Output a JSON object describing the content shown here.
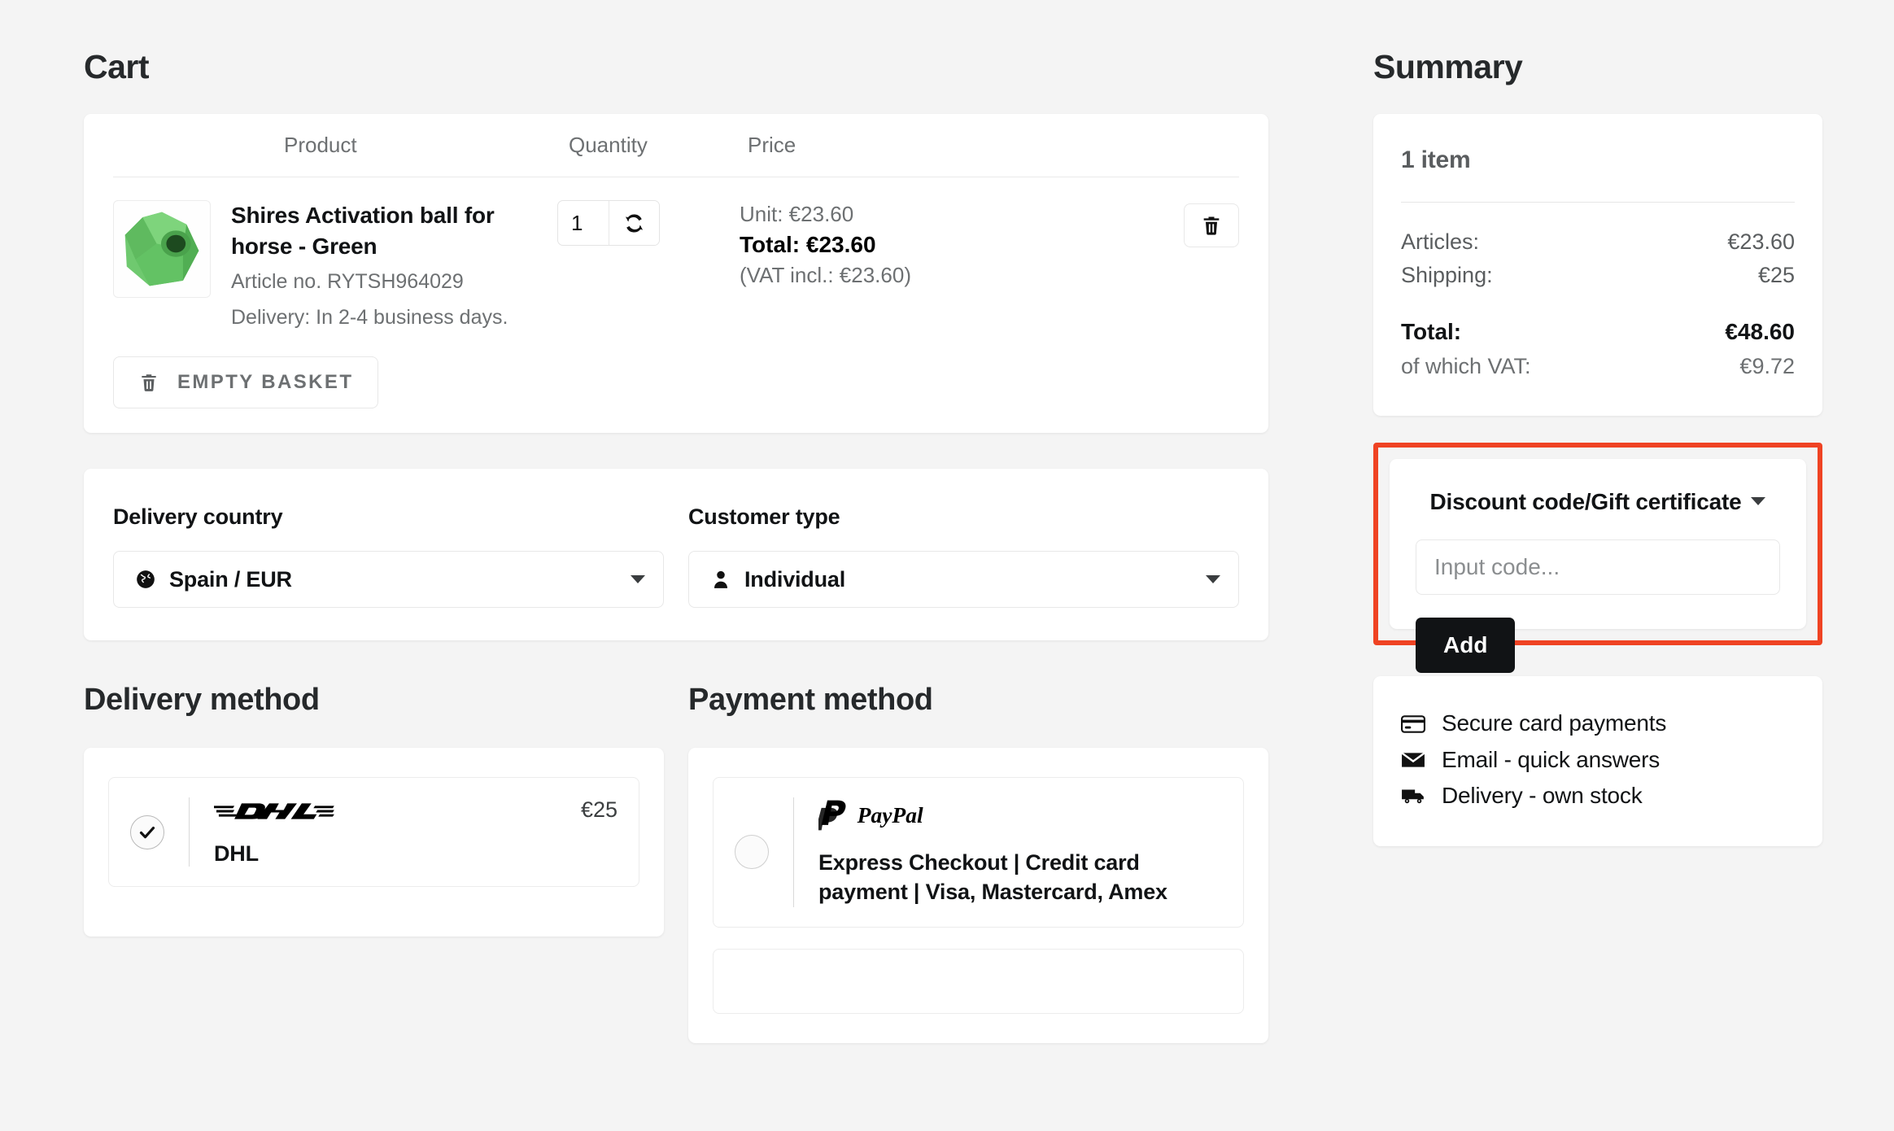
{
  "cart": {
    "title": "Cart",
    "columns": {
      "product": "Product",
      "quantity": "Quantity",
      "price": "Price"
    },
    "items": [
      {
        "name": "Shires Activation ball for horse - Green",
        "article_no": "Article no. RYTSH964029",
        "delivery": "Delivery: In 2-4 business days.",
        "quantity": "1",
        "unit_price": "Unit: €23.60",
        "total_price": "Total: €23.60",
        "vat_note": "(VAT incl.: €23.60)",
        "image_color": "#63c264"
      }
    ],
    "empty_basket_label": "EMPTY BASKET"
  },
  "options": {
    "delivery_country": {
      "label": "Delivery country",
      "value": "Spain / EUR"
    },
    "customer_type": {
      "label": "Customer type",
      "value": "Individual"
    }
  },
  "delivery_method": {
    "title": "Delivery method",
    "options": [
      {
        "logo": "DHL",
        "name": "DHL",
        "price": "€25",
        "selected": true
      }
    ]
  },
  "payment_method": {
    "title": "Payment method",
    "options": [
      {
        "logo": "PayPal",
        "description": "Express Checkout | Credit card payment | Visa, Mastercard, Amex",
        "selected": false
      }
    ]
  },
  "summary": {
    "title": "Summary",
    "item_count": "1 item",
    "rows": [
      {
        "label": "Articles:",
        "value": "€23.60"
      },
      {
        "label": "Shipping:",
        "value": "€25"
      }
    ],
    "total": {
      "label": "Total:",
      "value": "€48.60"
    },
    "vat": {
      "label": "of which VAT:",
      "value": "€9.72"
    }
  },
  "discount": {
    "title": "Discount code/Gift certificate",
    "input_placeholder": "Input code...",
    "input_value": "",
    "add_label": "Add",
    "highlight_color": "#ef4323"
  },
  "trust": {
    "items": [
      {
        "icon": "credit-card-icon",
        "label": "Secure card payments"
      },
      {
        "icon": "envelope-icon",
        "label": "Email - quick answers"
      },
      {
        "icon": "truck-icon",
        "label": "Delivery - own stock"
      }
    ]
  }
}
